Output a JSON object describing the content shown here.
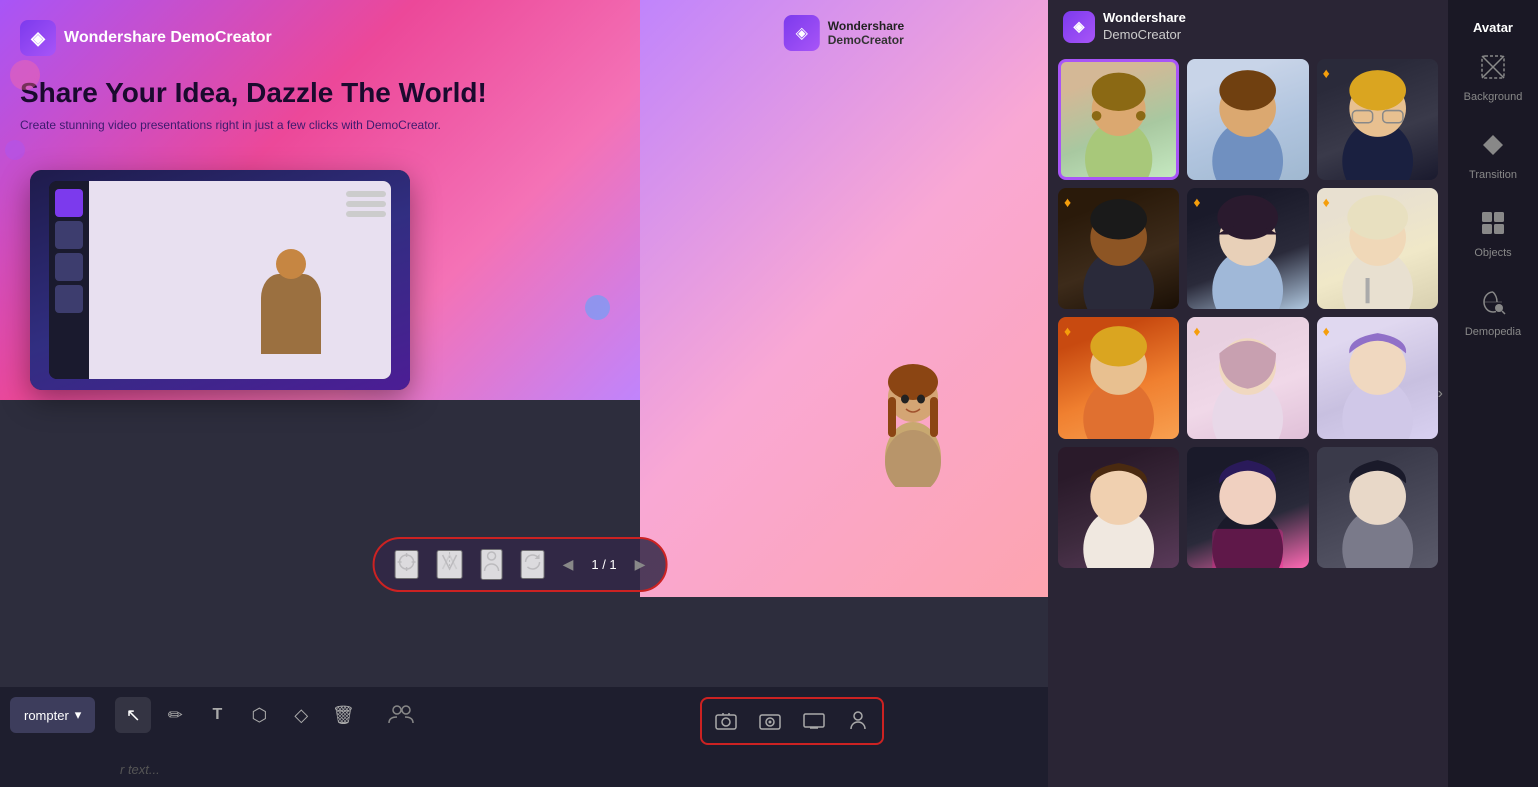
{
  "app": {
    "title": "Wondershare DemoCreator"
  },
  "header": {
    "logo_text": "Wondershare\nDemoCreator",
    "logo_icon": "◈"
  },
  "right_sidebar": {
    "active_tab": "Avatar",
    "tabs": [
      {
        "id": "avatar",
        "label": "Avatar",
        "icon": "👤",
        "active": true
      },
      {
        "id": "background",
        "label": "Background",
        "icon": "⊠"
      },
      {
        "id": "transition",
        "label": "Transition",
        "icon": "⏭"
      },
      {
        "id": "objects",
        "label": "Objects",
        "icon": "⊞"
      },
      {
        "id": "demopedia",
        "label": "Demopedia",
        "icon": "☁"
      }
    ]
  },
  "slide": {
    "logo": "Wondershare DemoCreator",
    "title": "Share Your Idea, Dazzle The World!",
    "subtitle": "Create stunning video presentations right in just a few clicks with DemoCreator."
  },
  "avatar_controls": {
    "page_indicator": "1 / 1",
    "buttons": [
      {
        "id": "target",
        "icon": "⊕"
      },
      {
        "id": "mirror",
        "icon": "⇔"
      },
      {
        "id": "person",
        "icon": "🧍"
      },
      {
        "id": "rotate",
        "icon": "↻"
      }
    ]
  },
  "toolbar": {
    "prompter_label": "rompter",
    "tools": [
      {
        "id": "select",
        "icon": "↖",
        "active": true
      },
      {
        "id": "pen",
        "icon": "✏"
      },
      {
        "id": "text",
        "icon": "T"
      },
      {
        "id": "shape",
        "icon": "⬡"
      },
      {
        "id": "eraser",
        "icon": "◇"
      },
      {
        "id": "delete",
        "icon": "🗑"
      }
    ],
    "text_placeholder": "r text...",
    "view_buttons": [
      {
        "id": "camera-bg",
        "icon": "🖥"
      },
      {
        "id": "camera-face",
        "icon": "🤳"
      },
      {
        "id": "screen",
        "icon": "▭"
      },
      {
        "id": "person2",
        "icon": "👤"
      }
    ],
    "extra_btn": "⊕"
  },
  "avatar_grid": {
    "avatars": [
      {
        "id": 1,
        "type": "av1",
        "selected": true,
        "premium": false
      },
      {
        "id": 2,
        "type": "av2",
        "selected": false,
        "premium": false
      },
      {
        "id": 3,
        "type": "av3",
        "selected": false,
        "premium": true
      },
      {
        "id": 4,
        "type": "av4",
        "selected": false,
        "premium": true
      },
      {
        "id": 5,
        "type": "av5",
        "selected": false,
        "premium": true
      },
      {
        "id": 6,
        "type": "av6",
        "selected": false,
        "premium": true
      },
      {
        "id": 7,
        "type": "av7",
        "selected": false,
        "premium": true
      },
      {
        "id": 8,
        "type": "av8",
        "selected": false,
        "premium": true
      },
      {
        "id": 9,
        "type": "av9",
        "selected": false,
        "premium": true
      },
      {
        "id": 10,
        "type": "av10",
        "selected": false,
        "premium": false
      },
      {
        "id": 11,
        "type": "av11",
        "selected": false,
        "premium": false
      },
      {
        "id": 12,
        "type": "av12",
        "selected": false,
        "premium": false
      }
    ]
  },
  "colors": {
    "accent_purple": "#a855f7",
    "accent_red": "#cc2222",
    "bg_dark": "#1a1825",
    "bg_mid": "#2a2535",
    "premium_gold": "#f59e0b"
  }
}
